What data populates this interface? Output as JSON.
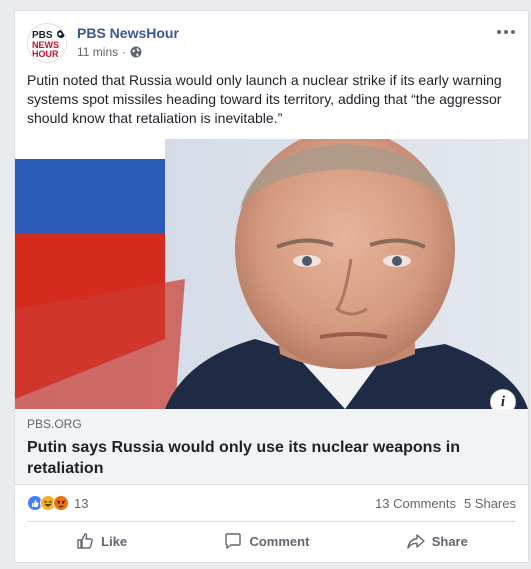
{
  "post": {
    "page_name": "PBS NewsHour",
    "logo_text": [
      "PBS",
      "NEWS",
      "HOUR"
    ],
    "timestamp": "11 mins",
    "separator": "·",
    "body": "Putin noted that Russia would only launch a nuclear strike if its early warning systems spot missiles heading toward its territory, adding that “the aggressor should know that retaliation is inevitable.”",
    "more_icon": "more-options-icon",
    "privacy_icon": "globe-icon"
  },
  "link": {
    "domain": "PBS.ORG",
    "title": "Putin says Russia would only use its nuclear weapons in retaliation",
    "info_label": "i"
  },
  "stats": {
    "reactions": [
      "like",
      "haha",
      "angry"
    ],
    "reaction_count": "13",
    "comments": "13 Comments",
    "shares": "5 Shares"
  },
  "actions": {
    "like": "Like",
    "comment": "Comment",
    "share": "Share"
  },
  "colors": {
    "brand_link": "#385898",
    "like_blue": "#4080ff",
    "haha_yellow": "#f7b125",
    "angry_orange": "#e9710f",
    "pbs_red": "#c8102e"
  }
}
